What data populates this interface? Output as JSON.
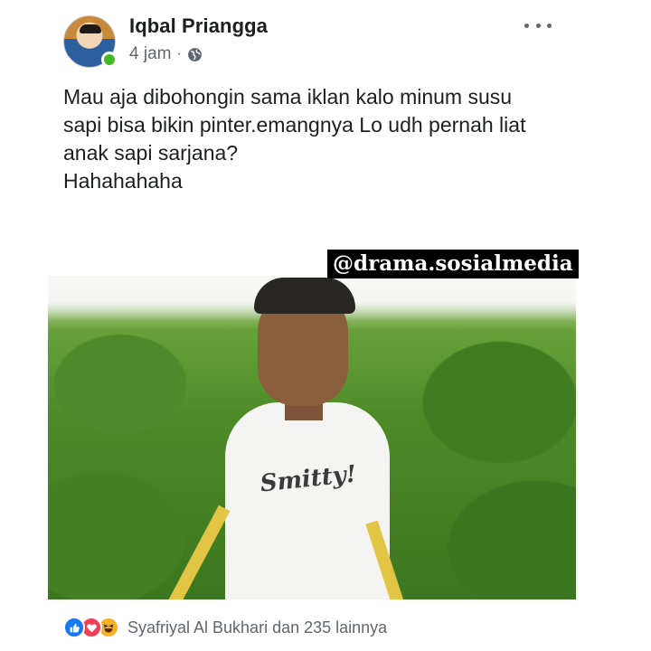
{
  "post": {
    "author": "Iqbal Priangga",
    "time": "4 jam",
    "separator": "·",
    "privacy_icon": "globe-icon",
    "menu_icon": "more-options-icon",
    "text_lines": [
      "Mau aja dibohongin sama iklan kalo minum susu",
      "sapi bisa bikin pinter.emangnya Lo udh pernah liat",
      "anak sapi sarjana?",
      "Hahahahaha"
    ],
    "photo": {
      "watermark": "@drama.sosialmedia",
      "shirt_text": "Smitty!"
    },
    "reactions": {
      "icons": [
        "like-icon",
        "love-icon",
        "haha-icon"
      ],
      "label": "Syafriyal Al Bukhari dan 235 lainnya"
    }
  },
  "colors": {
    "online": "#42b72a",
    "like": "#1877f2",
    "love": "#f33e58",
    "haha": "#f7b125",
    "secondary_text": "#606770"
  }
}
